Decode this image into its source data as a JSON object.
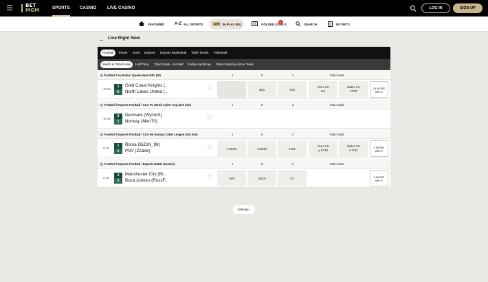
{
  "header": {
    "logo_line1": "BET",
    "logo_line2": "MGM",
    "nav": [
      "SPORTS",
      "CASINO",
      "LIVE CASINO"
    ],
    "login": "LOG IN",
    "signup": "SIGN UP"
  },
  "subnav": {
    "featured": "FEATURED",
    "all_sports": "ALL SPORTS",
    "live_badge": "LIVE",
    "in_play": "IN-PLAY (40)",
    "golden_goals": "GOLDEN GOALS",
    "golden_goals_count": "4",
    "search": "SEARCH",
    "my_bets": "MY BETS"
  },
  "page": {
    "title": "Live Right Now"
  },
  "sport_tabs": [
    "Football",
    "Tennis",
    "Darts",
    "Esports",
    "Esports Basketball",
    "Table Tennis",
    "Volleyball"
  ],
  "market_tabs": [
    "Match & Total Goals",
    "Half Time",
    "Total Goals - 1st Half",
    "3-Way Handicap",
    "Total Goals by Home Team"
  ],
  "events": [
    {
      "crumb": "Football / Australia / Queensland NPL (W)",
      "cols": [
        "1",
        "X",
        "2"
      ],
      "total_goals": "Total Goals",
      "time": "19:38",
      "score1": "1",
      "score2": "0",
      "team1": "Gold Coast Knights (...",
      "team2": "North Lakes United (...",
      "odds": [
        "",
        "35/1",
        "75/1"
      ],
      "over_label": "Over  4.5",
      "over_price": "6/4",
      "under_label": "Under  4.5",
      "under_price": "17/20",
      "more": "19 MORE BETS"
    },
    {
      "crumb": "Football / Esports Football / CLA-PL World Cyber Cup (2x5 min)",
      "cols": [
        "1",
        "X",
        "2"
      ],
      "total_goals": "Total Goals",
      "time": "10:39",
      "score1": "2",
      "score2": "1",
      "team1": "Denmark (WycreS)",
      "team2": "Norway (Metr70)"
    },
    {
      "crumb": "Football / Esports Football / CLA-UA Europa Cyber League (2x5 min)",
      "cols": [
        "1",
        "X",
        "2"
      ],
      "total_goals": "Total Goals",
      "time": "8:40",
      "score1": "1",
      "score2": "1",
      "team1": "Roma (BiZoN_98)",
      "team2": "PSV (Zzakki)",
      "odds": [
        "▾ 31/20",
        "▾ 21/20",
        "▾ 6/5"
      ],
      "over_label": "Over  3.5",
      "over_price": "▴ 17/10",
      "under_label": "Under  3.5",
      "under_price": "▾ 7/20",
      "more": "2 MORE BETS"
    },
    {
      "crumb": "Football / Esports Football / Esports Battle (2x4min)",
      "cols": [
        "1",
        "X",
        "2"
      ],
      "total_goals": "Total Goals",
      "time": "2:19",
      "score1": "1",
      "score2": "3",
      "team1": "Manchester City (Bl...",
      "team2": "Boca Juniors (RossF...",
      "odds": [
        "16/5",
        "25/10",
        "1/2"
      ],
      "more": "5 MORE BETS"
    }
  ],
  "footer": {
    "settings": "Settings ›"
  }
}
